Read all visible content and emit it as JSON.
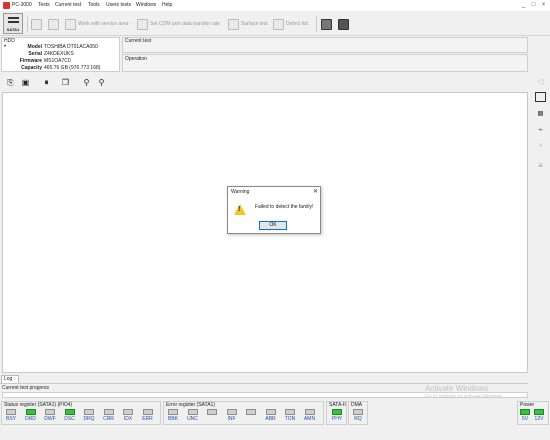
{
  "window": {
    "title": "PC-3000",
    "menu": [
      "Tests",
      "Current test",
      "Tools",
      "Users tests",
      "Windows",
      "Help"
    ],
    "controls": [
      "_",
      "□",
      "×"
    ]
  },
  "toolbar": {
    "sata_label": "SATA1",
    "items": [
      "Work with service area",
      "Set COM port data transfer rate",
      "Surface test",
      "Defect list"
    ]
  },
  "hdd": {
    "header": "HDD",
    "fields": [
      {
        "key": "Model",
        "value": "TOSHIBA DT01ACA050"
      },
      {
        "key": "Serial",
        "value": "Z4KDEXUKS"
      },
      {
        "key": "Firmware",
        "value": "MS1OA7C0"
      },
      {
        "key": "Capacity",
        "value": "465.76 GB (976 773 168)"
      }
    ]
  },
  "current_test": {
    "header": "Current test"
  },
  "operation": {
    "header": "Operation"
  },
  "dialog": {
    "title": "Warning",
    "close": "✕",
    "message": "Failed to detect the family!",
    "ok_label": "OK"
  },
  "log": {
    "tab_label": "Log"
  },
  "progress": {
    "label": "Current test progress"
  },
  "watermark": {
    "line1": "Activate Windows",
    "line2": "Go to Settings to activate Windows."
  },
  "registers": {
    "status": {
      "title": "Status register (SATA1) (PIO4)",
      "bits": [
        {
          "name": "BSY",
          "on": false
        },
        {
          "name": "DRD",
          "on": true
        },
        {
          "name": "DWF",
          "on": false
        },
        {
          "name": "DSC",
          "on": true
        },
        {
          "name": "DRQ",
          "on": false
        },
        {
          "name": "CRR",
          "on": false
        },
        {
          "name": "IDX",
          "on": false
        },
        {
          "name": "ERR",
          "on": false
        }
      ]
    },
    "error": {
      "title": "Error register (SATA1)",
      "bits": [
        {
          "name": "BBK",
          "on": false
        },
        {
          "name": "UNC",
          "on": false
        },
        {
          "name": "",
          "on": false
        },
        {
          "name": "INF",
          "on": false
        },
        {
          "name": "",
          "on": false
        },
        {
          "name": "ABR",
          "on": false
        },
        {
          "name": "TON",
          "on": false
        },
        {
          "name": "AMN",
          "on": false
        }
      ]
    },
    "sata2": {
      "title": "SATA-II",
      "bits": [
        {
          "name": "PHY",
          "on": true
        }
      ]
    },
    "dma": {
      "title": "DMA",
      "bits": [
        {
          "name": "RQ",
          "on": false
        }
      ]
    },
    "power": {
      "title": "Power",
      "bits": [
        {
          "name": "5V",
          "on": true
        },
        {
          "name": "12V",
          "on": true
        }
      ]
    }
  },
  "colors": {
    "led_on": "#36c43c",
    "led_off": "#cfcfcf",
    "accent": "#0078d7",
    "warning": "#f3c623",
    "app_icon": "#d9352b"
  }
}
